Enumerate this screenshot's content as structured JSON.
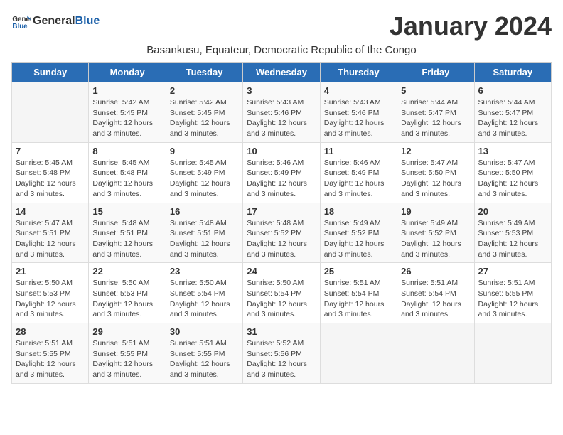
{
  "header": {
    "logo": {
      "text_general": "General",
      "text_blue": "Blue",
      "icon_color": "#1a5fa8"
    },
    "month_title": "January 2024",
    "subtitle": "Basankusu, Equateur, Democratic Republic of the Congo"
  },
  "calendar": {
    "days_of_week": [
      "Sunday",
      "Monday",
      "Tuesday",
      "Wednesday",
      "Thursday",
      "Friday",
      "Saturday"
    ],
    "weeks": [
      [
        {
          "day": "",
          "info": ""
        },
        {
          "day": "1",
          "info": "Sunrise: 5:42 AM\nSunset: 5:45 PM\nDaylight: 12 hours\nand 3 minutes."
        },
        {
          "day": "2",
          "info": "Sunrise: 5:42 AM\nSunset: 5:45 PM\nDaylight: 12 hours\nand 3 minutes."
        },
        {
          "day": "3",
          "info": "Sunrise: 5:43 AM\nSunset: 5:46 PM\nDaylight: 12 hours\nand 3 minutes."
        },
        {
          "day": "4",
          "info": "Sunrise: 5:43 AM\nSunset: 5:46 PM\nDaylight: 12 hours\nand 3 minutes."
        },
        {
          "day": "5",
          "info": "Sunrise: 5:44 AM\nSunset: 5:47 PM\nDaylight: 12 hours\nand 3 minutes."
        },
        {
          "day": "6",
          "info": "Sunrise: 5:44 AM\nSunset: 5:47 PM\nDaylight: 12 hours\nand 3 minutes."
        }
      ],
      [
        {
          "day": "7",
          "info": "Sunrise: 5:45 AM\nSunset: 5:48 PM\nDaylight: 12 hours\nand 3 minutes."
        },
        {
          "day": "8",
          "info": "Sunrise: 5:45 AM\nSunset: 5:48 PM\nDaylight: 12 hours\nand 3 minutes."
        },
        {
          "day": "9",
          "info": "Sunrise: 5:45 AM\nSunset: 5:49 PM\nDaylight: 12 hours\nand 3 minutes."
        },
        {
          "day": "10",
          "info": "Sunrise: 5:46 AM\nSunset: 5:49 PM\nDaylight: 12 hours\nand 3 minutes."
        },
        {
          "day": "11",
          "info": "Sunrise: 5:46 AM\nSunset: 5:49 PM\nDaylight: 12 hours\nand 3 minutes."
        },
        {
          "day": "12",
          "info": "Sunrise: 5:47 AM\nSunset: 5:50 PM\nDaylight: 12 hours\nand 3 minutes."
        },
        {
          "day": "13",
          "info": "Sunrise: 5:47 AM\nSunset: 5:50 PM\nDaylight: 12 hours\nand 3 minutes."
        }
      ],
      [
        {
          "day": "14",
          "info": "Sunrise: 5:47 AM\nSunset: 5:51 PM\nDaylight: 12 hours\nand 3 minutes."
        },
        {
          "day": "15",
          "info": "Sunrise: 5:48 AM\nSunset: 5:51 PM\nDaylight: 12 hours\nand 3 minutes."
        },
        {
          "day": "16",
          "info": "Sunrise: 5:48 AM\nSunset: 5:51 PM\nDaylight: 12 hours\nand 3 minutes."
        },
        {
          "day": "17",
          "info": "Sunrise: 5:48 AM\nSunset: 5:52 PM\nDaylight: 12 hours\nand 3 minutes."
        },
        {
          "day": "18",
          "info": "Sunrise: 5:49 AM\nSunset: 5:52 PM\nDaylight: 12 hours\nand 3 minutes."
        },
        {
          "day": "19",
          "info": "Sunrise: 5:49 AM\nSunset: 5:52 PM\nDaylight: 12 hours\nand 3 minutes."
        },
        {
          "day": "20",
          "info": "Sunrise: 5:49 AM\nSunset: 5:53 PM\nDaylight: 12 hours\nand 3 minutes."
        }
      ],
      [
        {
          "day": "21",
          "info": "Sunrise: 5:50 AM\nSunset: 5:53 PM\nDaylight: 12 hours\nand 3 minutes."
        },
        {
          "day": "22",
          "info": "Sunrise: 5:50 AM\nSunset: 5:53 PM\nDaylight: 12 hours\nand 3 minutes."
        },
        {
          "day": "23",
          "info": "Sunrise: 5:50 AM\nSunset: 5:54 PM\nDaylight: 12 hours\nand 3 minutes."
        },
        {
          "day": "24",
          "info": "Sunrise: 5:50 AM\nSunset: 5:54 PM\nDaylight: 12 hours\nand 3 minutes."
        },
        {
          "day": "25",
          "info": "Sunrise: 5:51 AM\nSunset: 5:54 PM\nDaylight: 12 hours\nand 3 minutes."
        },
        {
          "day": "26",
          "info": "Sunrise: 5:51 AM\nSunset: 5:54 PM\nDaylight: 12 hours\nand 3 minutes."
        },
        {
          "day": "27",
          "info": "Sunrise: 5:51 AM\nSunset: 5:55 PM\nDaylight: 12 hours\nand 3 minutes."
        }
      ],
      [
        {
          "day": "28",
          "info": "Sunrise: 5:51 AM\nSunset: 5:55 PM\nDaylight: 12 hours\nand 3 minutes."
        },
        {
          "day": "29",
          "info": "Sunrise: 5:51 AM\nSunset: 5:55 PM\nDaylight: 12 hours\nand 3 minutes."
        },
        {
          "day": "30",
          "info": "Sunrise: 5:51 AM\nSunset: 5:55 PM\nDaylight: 12 hours\nand 3 minutes."
        },
        {
          "day": "31",
          "info": "Sunrise: 5:52 AM\nSunset: 5:56 PM\nDaylight: 12 hours\nand 3 minutes."
        },
        {
          "day": "",
          "info": ""
        },
        {
          "day": "",
          "info": ""
        },
        {
          "day": "",
          "info": ""
        }
      ]
    ]
  }
}
